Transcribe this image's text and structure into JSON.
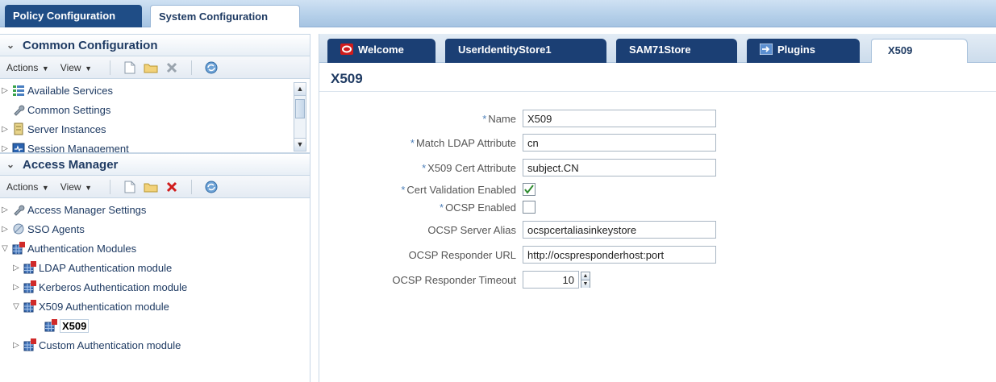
{
  "top_tabs": [
    "Policy Configuration",
    "System Configuration"
  ],
  "common": {
    "title": "Common Configuration",
    "toolbar": {
      "actions": "Actions",
      "view": "View"
    },
    "items": [
      "Available Services",
      "Common Settings",
      "Server Instances",
      "Session Management"
    ]
  },
  "access": {
    "title": "Access Manager",
    "toolbar": {
      "actions": "Actions",
      "view": "View"
    },
    "items": [
      "Access Manager Settings",
      "SSO Agents",
      "Authentication Modules",
      "LDAP Authentication module",
      "Kerberos Authentication module",
      "X509 Authentication module",
      "X509",
      "Custom Authentication module"
    ]
  },
  "content_tabs": [
    "Welcome",
    "UserIdentityStore1",
    "SAM71Store",
    "Plugins",
    "X509"
  ],
  "page_title": "X509",
  "form": {
    "name_label": "Name",
    "name_value": "X509",
    "ldap_label": "Match LDAP Attribute",
    "ldap_value": "cn",
    "cert_attr_label": "X509 Cert Attribute",
    "cert_attr_value": "subject.CN",
    "cert_validation_label": "Cert Validation Enabled",
    "cert_validation_checked": true,
    "ocsp_enabled_label": "OCSP Enabled",
    "ocsp_enabled_checked": false,
    "ocsp_alias_label": "OCSP Server Alias",
    "ocsp_alias_value": "ocspcertaliasinkeystore",
    "ocsp_url_label": "OCSP Responder URL",
    "ocsp_url_value": "http://ocspresponderhost:port",
    "ocsp_timeout_label": "OCSP Responder Timeout",
    "ocsp_timeout_value": "10",
    "required_mark": "*"
  },
  "colors": {
    "accent": "#1f3b63",
    "tab_dark": "#1b3f74",
    "required": "#4d7fb8",
    "delete_red": "#d01c1c"
  }
}
